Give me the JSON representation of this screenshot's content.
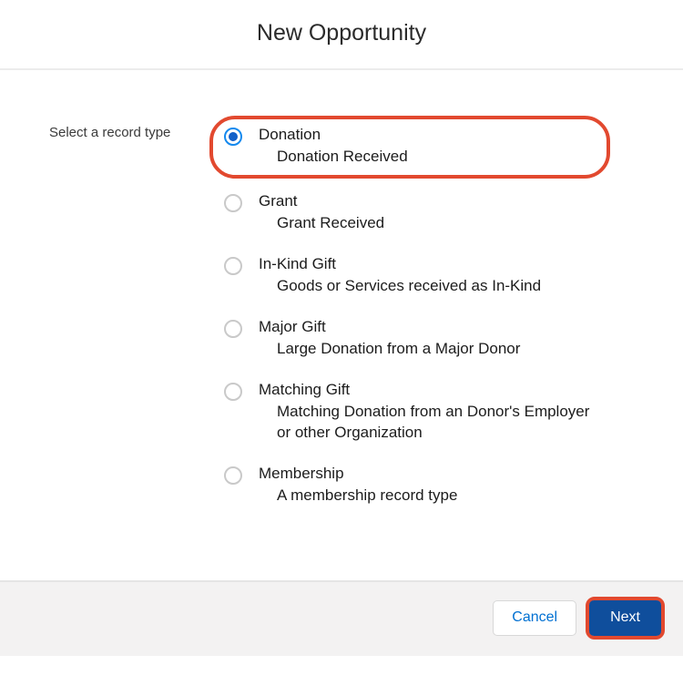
{
  "header": {
    "title": "New Opportunity"
  },
  "form": {
    "label": "Select a record type",
    "options": [
      {
        "title": "Donation",
        "desc": "Donation Received",
        "selected": true,
        "highlighted": true
      },
      {
        "title": "Grant",
        "desc": "Grant Received",
        "selected": false,
        "highlighted": false
      },
      {
        "title": "In-Kind Gift",
        "desc": "Goods or Services received as In-Kind",
        "selected": false,
        "highlighted": false
      },
      {
        "title": "Major Gift",
        "desc": "Large Donation from a Major Donor",
        "selected": false,
        "highlighted": false
      },
      {
        "title": "Matching Gift",
        "desc": "Matching Donation from an Donor's Employer or other Organization",
        "selected": false,
        "highlighted": false
      },
      {
        "title": "Membership",
        "desc": "A membership record type",
        "selected": false,
        "highlighted": false
      }
    ]
  },
  "footer": {
    "cancel": "Cancel",
    "next": "Next",
    "next_highlighted": true
  }
}
